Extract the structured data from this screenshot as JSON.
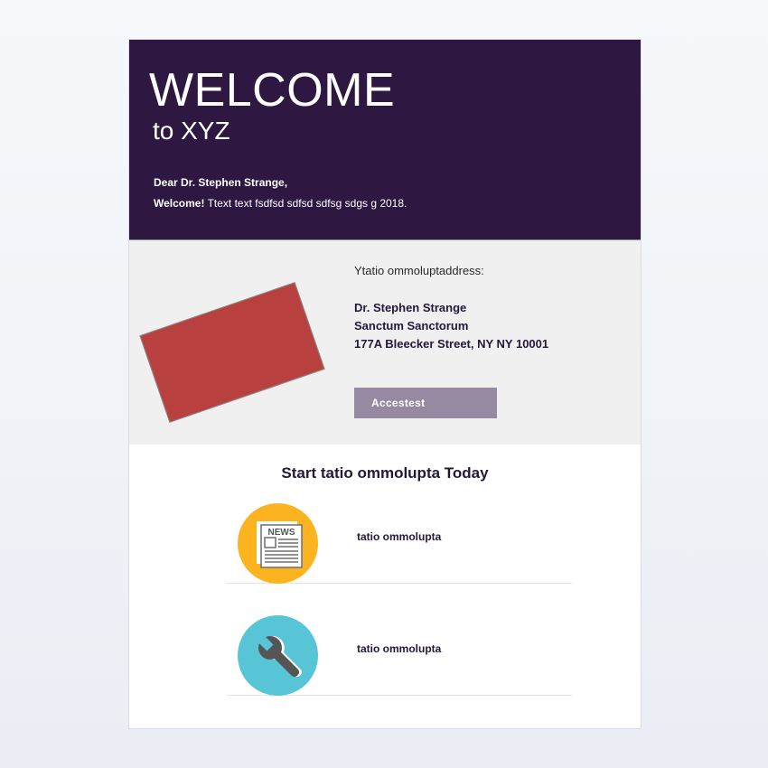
{
  "hero": {
    "title": "WELCOME",
    "subtitle": "to XYZ",
    "greeting": "Dear Dr. Stephen Strange,",
    "intro_bold": "Welcome!",
    "intro_text": " Ttext text fsdfsd sdfsd sdfsg sdgs g 2018.",
    "background": "#2e1841"
  },
  "address": {
    "label": "Ytatio ommoluptaddress:",
    "lines": [
      "Dr. Stephen Strange",
      "Sanctum Sanctorum",
      "177A Bleecker Street, NY NY 10001"
    ],
    "button_label": "Accestest",
    "card_color": "#b84140",
    "button_color": "#968aa2"
  },
  "start": {
    "title": "Start tatio ommolupta Today",
    "features": [
      {
        "label": "tatio ommolupta",
        "icon": "newspaper-icon",
        "icon_text": "NEWS",
        "color": "#fbb31f"
      },
      {
        "label": "tatio ommolupta",
        "icon": "wrench-icon",
        "color": "#58c5d7"
      }
    ]
  }
}
